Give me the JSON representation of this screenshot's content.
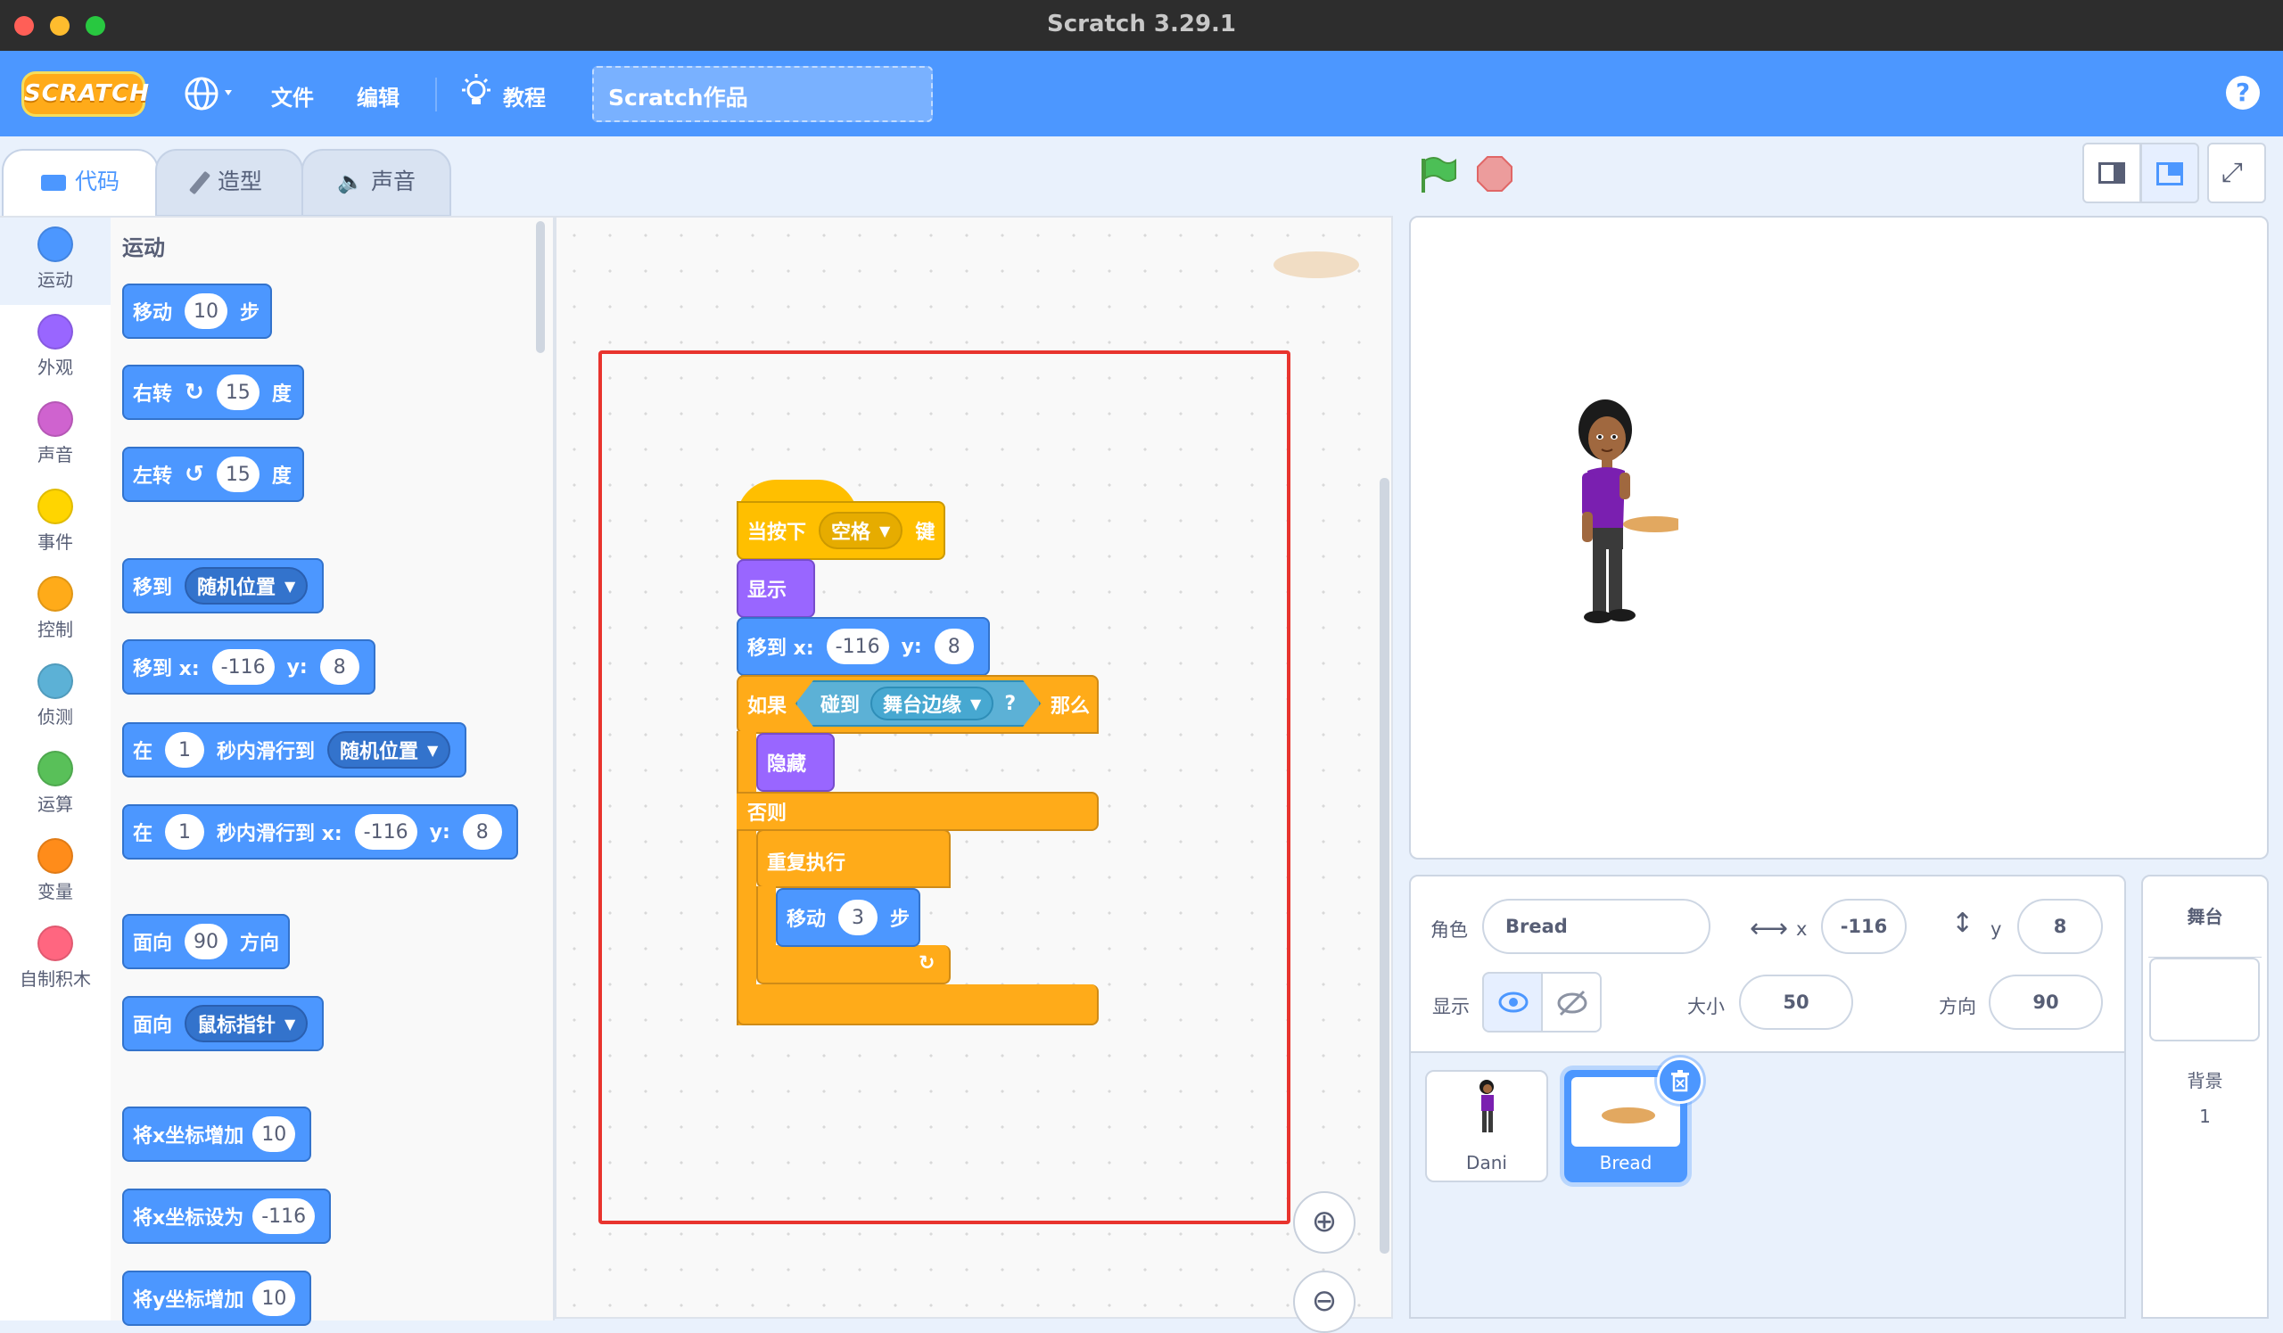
{
  "window": {
    "title": "Scratch 3.29.1"
  },
  "menubar": {
    "file": "文件",
    "edit": "编辑",
    "tutorials": "教程",
    "project_title": "Scratch作品",
    "help": "?",
    "logo": "SCRATCH"
  },
  "tabs": {
    "code": "代码",
    "costumes": "造型",
    "sounds": "声音"
  },
  "categories": [
    {
      "label": "运动",
      "color": "#4c97ff"
    },
    {
      "label": "外观",
      "color": "#9966ff"
    },
    {
      "label": "声音",
      "color": "#cf63cf"
    },
    {
      "label": "事件",
      "color": "#ffd500"
    },
    {
      "label": "控制",
      "color": "#ffab19"
    },
    {
      "label": "侦测",
      "color": "#5cb1d6"
    },
    {
      "label": "运算",
      "color": "#59c059"
    },
    {
      "label": "变量",
      "color": "#ff8c1a"
    },
    {
      "label": "自制积木",
      "color": "#ff6680"
    }
  ],
  "palette": {
    "heading": "运动",
    "move": {
      "a": "移动",
      "v": "10",
      "b": "步"
    },
    "turn_right": {
      "a": "右转",
      "v": "15",
      "b": "度"
    },
    "turn_left": {
      "a": "左转",
      "v": "15",
      "b": "度"
    },
    "goto": {
      "a": "移到",
      "dd": "随机位置"
    },
    "goto_xy": {
      "a": "移到 x:",
      "x": "-116",
      "ylbl": "y:",
      "y": "8"
    },
    "glide": {
      "a": "在",
      "v": "1",
      "b": "秒内滑行到",
      "dd": "随机位置"
    },
    "glide_xy": {
      "a": "在",
      "v": "1",
      "b": "秒内滑行到 x:",
      "x": "-116",
      "ylbl": "y:",
      "y": "8"
    },
    "point_dir": {
      "a": "面向",
      "v": "90",
      "b": "方向"
    },
    "point_towards": {
      "a": "面向",
      "dd": "鼠标指针"
    },
    "change_x": {
      "a": "将x坐标增加",
      "v": "10"
    },
    "set_x": {
      "a": "将x坐标设为",
      "v": "-116"
    },
    "change_y": {
      "a": "将y坐标增加",
      "v": "10"
    }
  },
  "script": {
    "hat": {
      "a": "当按下",
      "dd": "空格",
      "b": "键"
    },
    "show": "显示",
    "goto_xy": {
      "a": "移到 x:",
      "x": "-116",
      "ylbl": "y:",
      "y": "8"
    },
    "if": {
      "a": "如果",
      "touch": "碰到",
      "dd": "舞台边缘",
      "q": "?",
      "b": "那么"
    },
    "hide": "隐藏",
    "else": "否则",
    "forever": "重复执行",
    "move": {
      "a": "移动",
      "v": "3",
      "b": "步"
    }
  },
  "sprite_info": {
    "sprite_label": "角色",
    "sprite_name": "Bread",
    "x_label": "x",
    "x": "-116",
    "y_label": "y",
    "y": "8",
    "show_label": "显示",
    "size_label": "大小",
    "size": "50",
    "direction_label": "方向",
    "direction": "90"
  },
  "sprites": [
    {
      "name": "Dani"
    },
    {
      "name": "Bread"
    }
  ],
  "stage_panel": {
    "title": "舞台",
    "backdrop_label": "背景",
    "backdrop_count": "1"
  }
}
